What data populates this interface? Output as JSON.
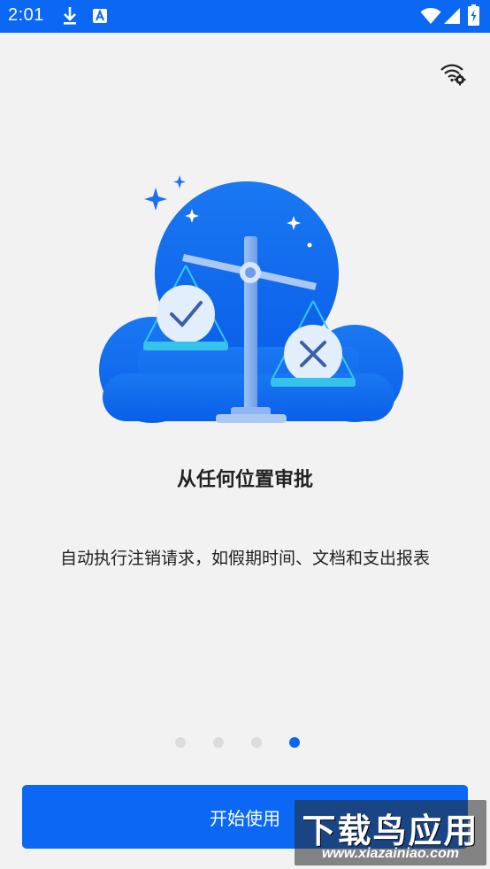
{
  "status_bar": {
    "time": "2:01",
    "icons": [
      "download-icon",
      "app-notification-icon",
      "wifi-icon",
      "signal-icon",
      "battery-icon"
    ]
  },
  "top_action": {
    "icon": "wifi-settings-icon"
  },
  "illustration": {
    "icon": "scales-of-justice-illustration"
  },
  "onboarding": {
    "title": "从任何位置审批",
    "description": "自动执行注销请求，如假期时间、文档和支出报表",
    "page_count": 4,
    "current_page": 4
  },
  "start_button": {
    "label": "开始使用"
  },
  "watermark": {
    "title": "下载鸟应用",
    "url": "www.xiazainiao.com"
  },
  "colors": {
    "accent": "#0a68f5",
    "background": "#f2f2f2",
    "dot_inactive": "#dcdcdc"
  }
}
